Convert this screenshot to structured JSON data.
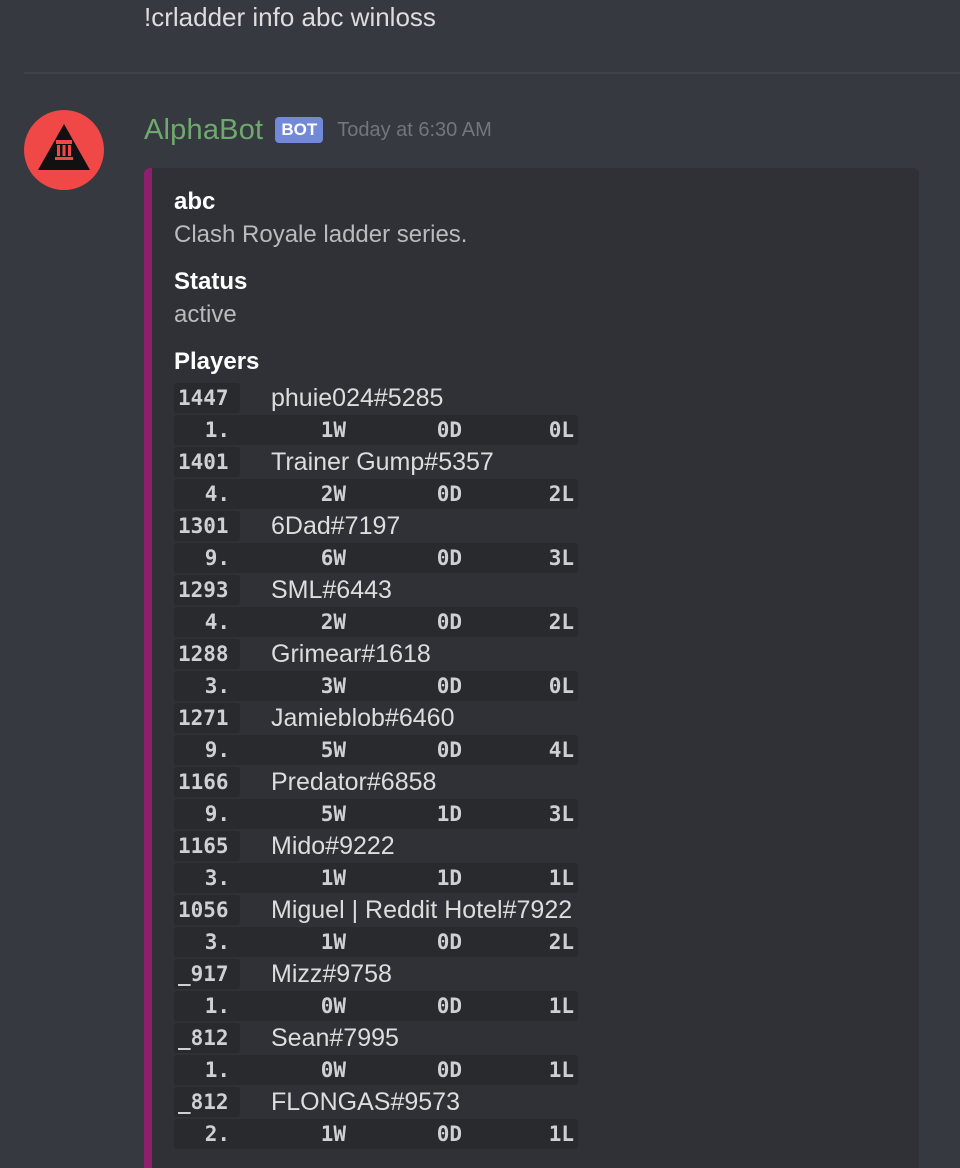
{
  "previous_message": {
    "text": "!crladder info abc winloss"
  },
  "message": {
    "author": "AlphaBot",
    "bot_tag": "BOT",
    "timestamp": "Today at 6:30 AM",
    "author_color": "#6fa96f",
    "embed": {
      "accent_color": "#8e1f6c",
      "title": "abc",
      "description": "Clash Royale ladder series.",
      "fields": {
        "status_label": "Status",
        "status_value": "active",
        "players_label": "Players"
      },
      "players": [
        {
          "rating": "1447",
          "name": "phuie024#5285",
          "rank": "1.",
          "wins": "1W",
          "draws": "0D",
          "losses": "0L"
        },
        {
          "rating": "1401",
          "name": "Trainer Gump#5357",
          "rank": "4.",
          "wins": "2W",
          "draws": "0D",
          "losses": "2L"
        },
        {
          "rating": "1301",
          "name": "6Dad#7197",
          "rank": "9.",
          "wins": "6W",
          "draws": "0D",
          "losses": "3L"
        },
        {
          "rating": "1293",
          "name": "SML#6443",
          "rank": "4.",
          "wins": "2W",
          "draws": "0D",
          "losses": "2L"
        },
        {
          "rating": "1288",
          "name": "Grimear#1618",
          "rank": "3.",
          "wins": "3W",
          "draws": "0D",
          "losses": "0L"
        },
        {
          "rating": "1271",
          "name": "Jamieblob#6460",
          "rank": "9.",
          "wins": "5W",
          "draws": "0D",
          "losses": "4L"
        },
        {
          "rating": "1166",
          "name": "Predator#6858",
          "rank": "9.",
          "wins": "5W",
          "draws": "1D",
          "losses": "3L"
        },
        {
          "rating": "1165",
          "name": "Mido#9222",
          "rank": "3.",
          "wins": "1W",
          "draws": "1D",
          "losses": "1L"
        },
        {
          "rating": "1056",
          "name": "Miguel | Reddit Hotel#7922",
          "rank": "3.",
          "wins": "1W",
          "draws": "0D",
          "losses": "2L"
        },
        {
          "rating": "_917",
          "name": "Mizz#9758",
          "rank": "1.",
          "wins": "0W",
          "draws": "0D",
          "losses": "1L"
        },
        {
          "rating": "_812",
          "name": "Sean#7995",
          "rank": "1.",
          "wins": "0W",
          "draws": "0D",
          "losses": "1L"
        },
        {
          "rating": "_812",
          "name": "FLONGAS#9573",
          "rank": "2.",
          "wins": "1W",
          "draws": "0D",
          "losses": "1L"
        }
      ]
    }
  },
  "icons": {
    "avatar": "alphabot-logo-icon"
  },
  "colors": {
    "background": "#36393f",
    "embed_background": "#2f3136",
    "bot_tag": "#7289da",
    "avatar_background": "#f04747"
  }
}
